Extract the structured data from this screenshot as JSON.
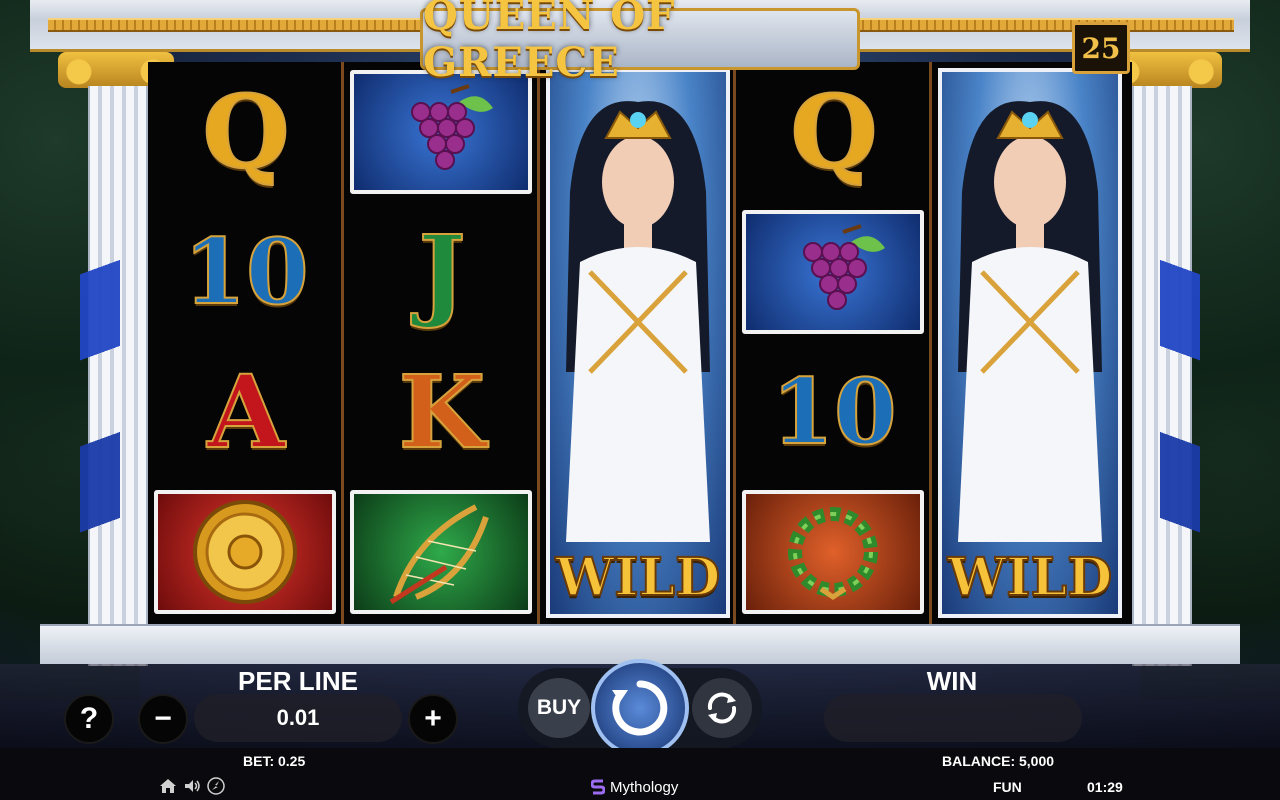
{
  "game": {
    "title": "QUEEN OF GREECE",
    "lines": "25"
  },
  "reels": [
    [
      "Q",
      "10",
      "A",
      "shield"
    ],
    [
      "grapes",
      "J",
      "K",
      "lyre"
    ],
    [
      "wild"
    ],
    [
      "Q",
      "grapes",
      "10",
      "wreath"
    ],
    [
      "wild"
    ]
  ],
  "symbols": {
    "wild_label": "WILD"
  },
  "controls": {
    "help_label": "?",
    "per_line_label": "PER LINE",
    "per_line_value": "0.01",
    "minus_label": "−",
    "plus_label": "+",
    "buy_label": "BUY",
    "win_label": "WIN",
    "win_value": ""
  },
  "status": {
    "bet_text": "BET: 0.25",
    "balance_text": "BALANCE: 5,000",
    "mode": "FUN",
    "clock": "01:29",
    "provider": "Mythology"
  },
  "colors": {
    "accent_gold": "#f5c542",
    "spin_blue": "#3a6cc0",
    "drape_blue": "#2146c4"
  }
}
